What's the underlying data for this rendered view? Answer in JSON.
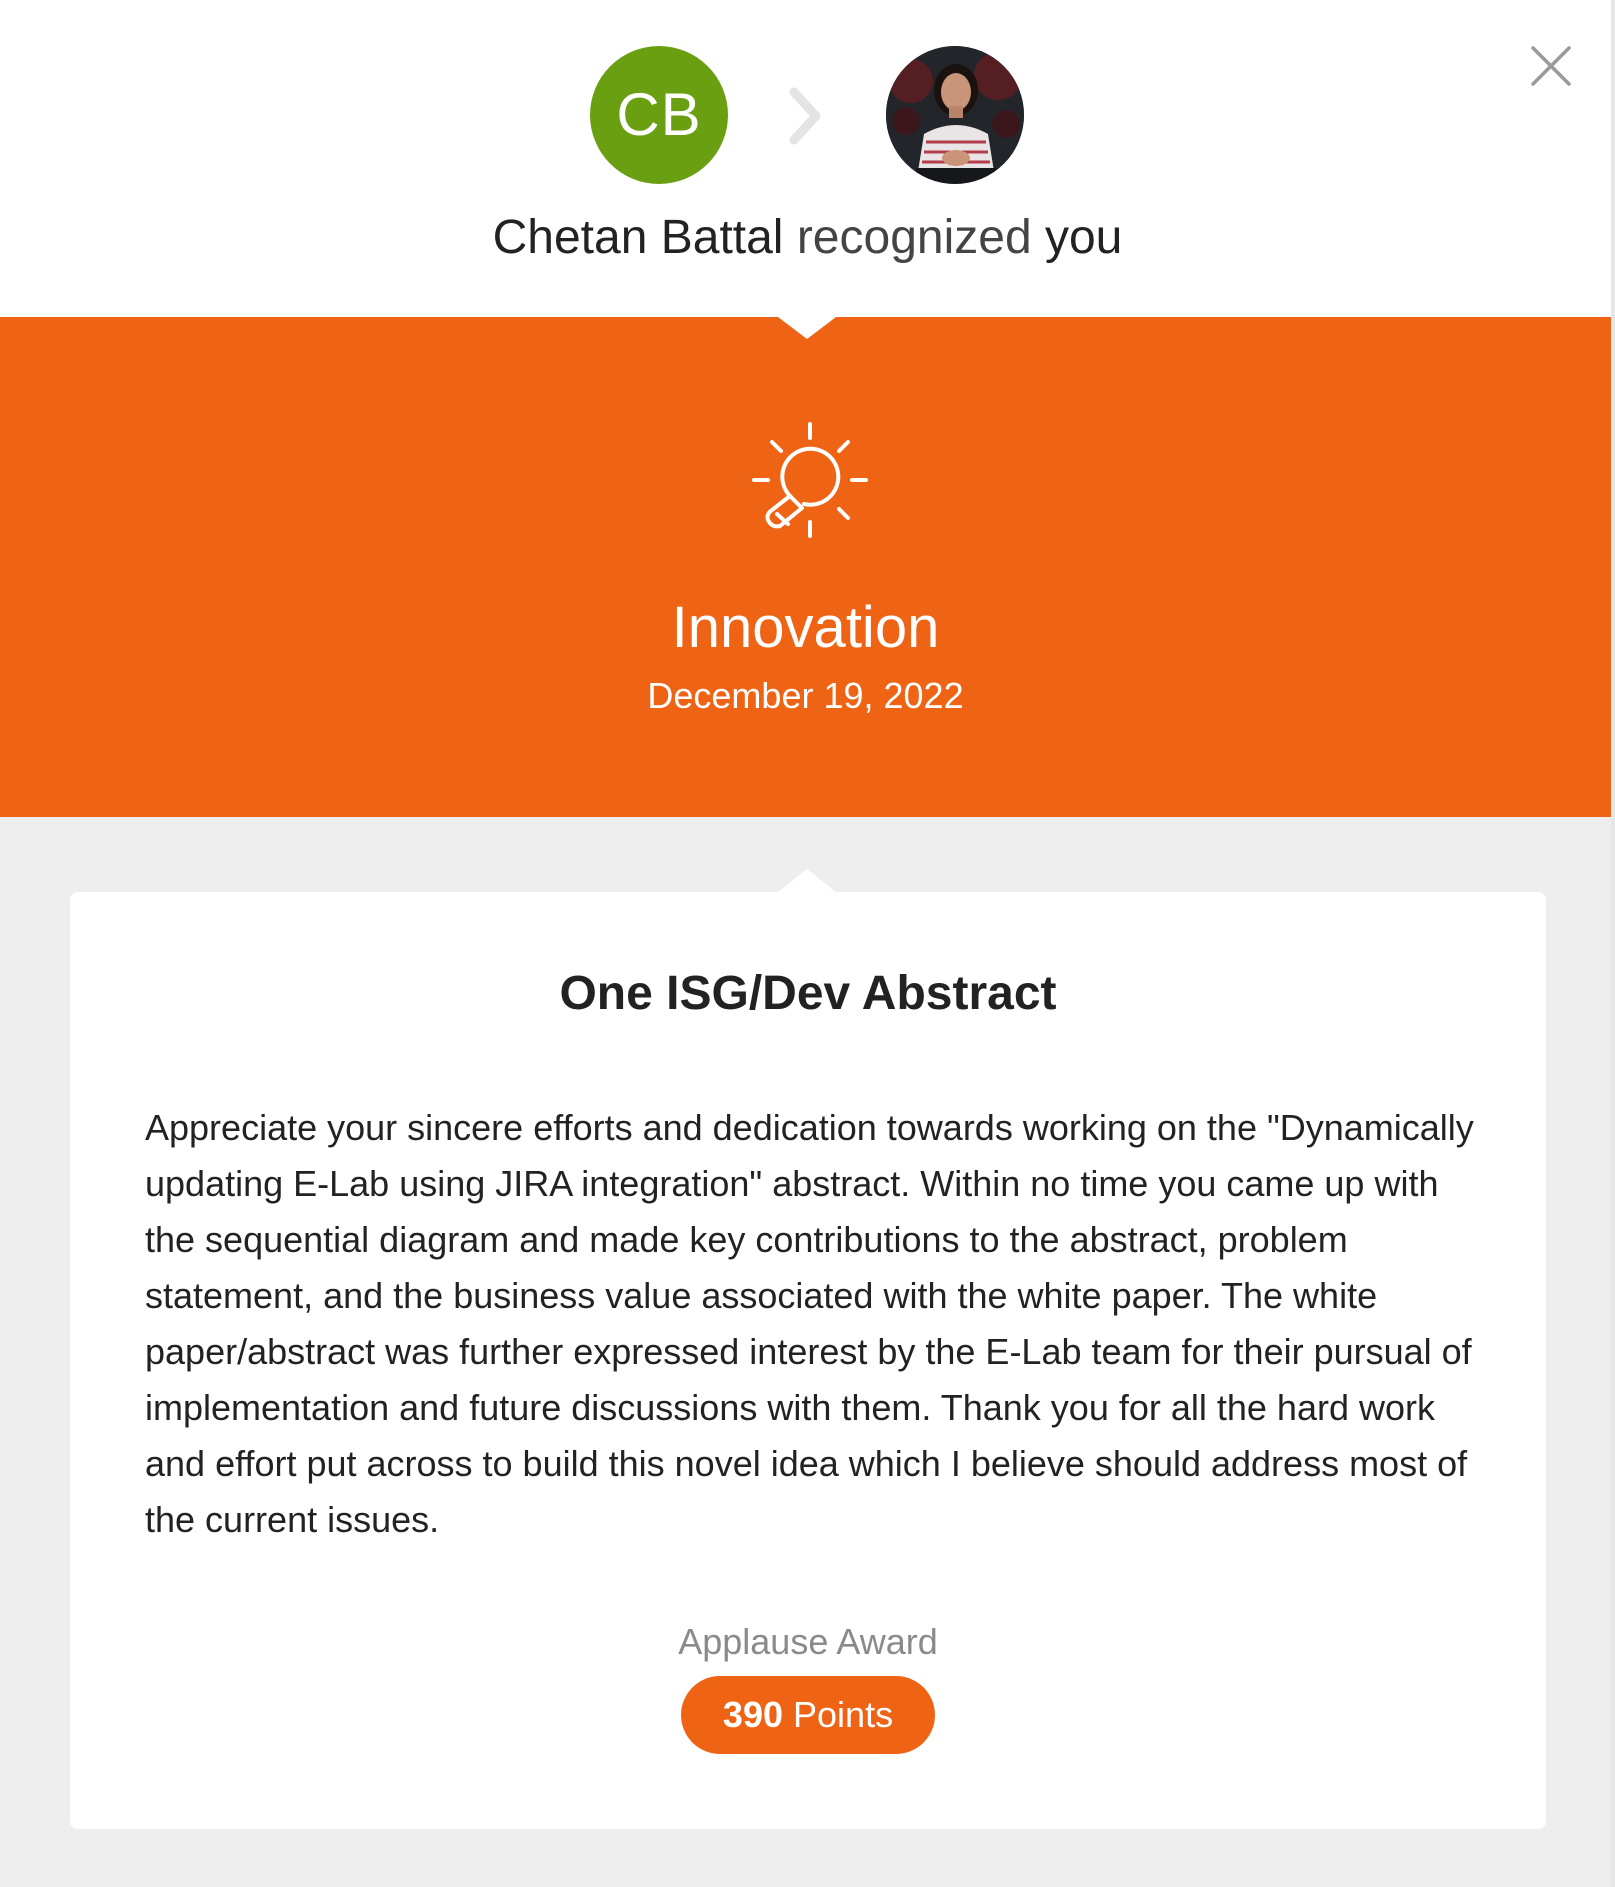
{
  "header": {
    "giver_initials": "CB",
    "giver_name": "Chetan Battal",
    "verb": "recognized",
    "recipient": "you",
    "close_icon": "close-icon",
    "arrow_icon": "chevron-right-icon",
    "giver_avatar_color": "#6a9f12"
  },
  "banner": {
    "icon": "lightbulb-idea-icon",
    "title": "Innovation",
    "date": "December 19, 2022",
    "color": "#ef6414"
  },
  "card": {
    "title": "One ISG/Dev Abstract",
    "message": "Appreciate your sincere efforts and dedication towards working on the \"Dynamically updating E-Lab using JIRA integration\" abstract. Within no time you came up with the sequential diagram and made key contributions to the abstract, problem statement, and the business value associated with the white paper. The white paper/abstract was further expressed interest by the E-Lab team for their pursual of implementation and future discussions with them. Thank you for all the hard work and effort put across to build this novel idea which I believe should address most of the current issues.",
    "award_label": "Applause Award",
    "points_value": "390",
    "points_unit": "Points"
  }
}
